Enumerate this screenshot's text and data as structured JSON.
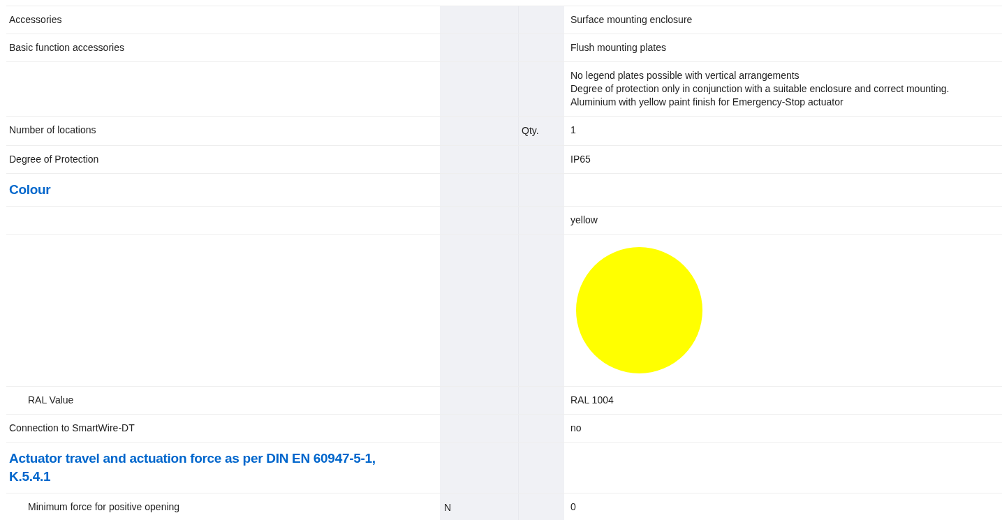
{
  "rows": [
    {
      "kind": "row",
      "label": "Accessories",
      "value": [
        "Surface mounting enclosure"
      ]
    },
    {
      "kind": "row",
      "label": "Basic function accessories",
      "value": [
        "Flush mounting plates"
      ]
    },
    {
      "kind": "row",
      "label": "",
      "value": [
        "No legend plates possible with vertical arrangements",
        "Degree of protection only in conjunction with a suitable enclosure and correct mounting.",
        "Aluminium with yellow paint finish for Emergency-Stop actuator"
      ]
    },
    {
      "kind": "row",
      "label": "Number of locations",
      "column_3": "Qty.",
      "value": [
        "1"
      ]
    },
    {
      "kind": "row",
      "label": "Degree of Protection",
      "value": [
        "IP65"
      ]
    },
    {
      "kind": "heading",
      "label": "Colour"
    },
    {
      "kind": "row",
      "label": "",
      "value": [
        "yellow"
      ]
    },
    {
      "kind": "swatch",
      "color": "#ffff00"
    },
    {
      "kind": "row",
      "label": "RAL Value",
      "indented": true,
      "value": [
        "RAL 1004"
      ]
    },
    {
      "kind": "row",
      "label": "Connection to SmartWire-DT",
      "value": [
        "no"
      ]
    },
    {
      "kind": "heading",
      "label": "Actuator travel and actuation force as per DIN EN 60947-5-1, K.5.4.1"
    },
    {
      "kind": "row",
      "label": "Minimum force for positive opening",
      "indented": true,
      "column_2": "N",
      "value": [
        "0"
      ]
    }
  ]
}
